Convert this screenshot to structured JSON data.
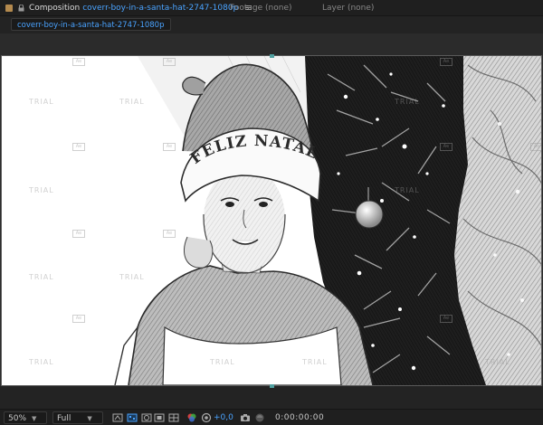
{
  "panel": {
    "composition_label": "Composition",
    "composition_name": "coverr-boy-in-a-santa-hat-2747-1080p",
    "footage_tab": "Footage (none)",
    "layer_tab": "Layer (none)"
  },
  "breadcrumb": {
    "comp": "coverr-boy-in-a-santa-hat-2747-1080p"
  },
  "viewer": {
    "hat_text": "FELIZ NATAL",
    "watermark": "TRIAL"
  },
  "toolbar": {
    "zoom": "50%",
    "resolution": "Full",
    "exposure": "+0,0",
    "timecode": "0:00:00:00"
  },
  "colors": {
    "accent": "#4aa3ff",
    "panel_bg": "#232323",
    "comp_chip": "#b48a4e"
  }
}
